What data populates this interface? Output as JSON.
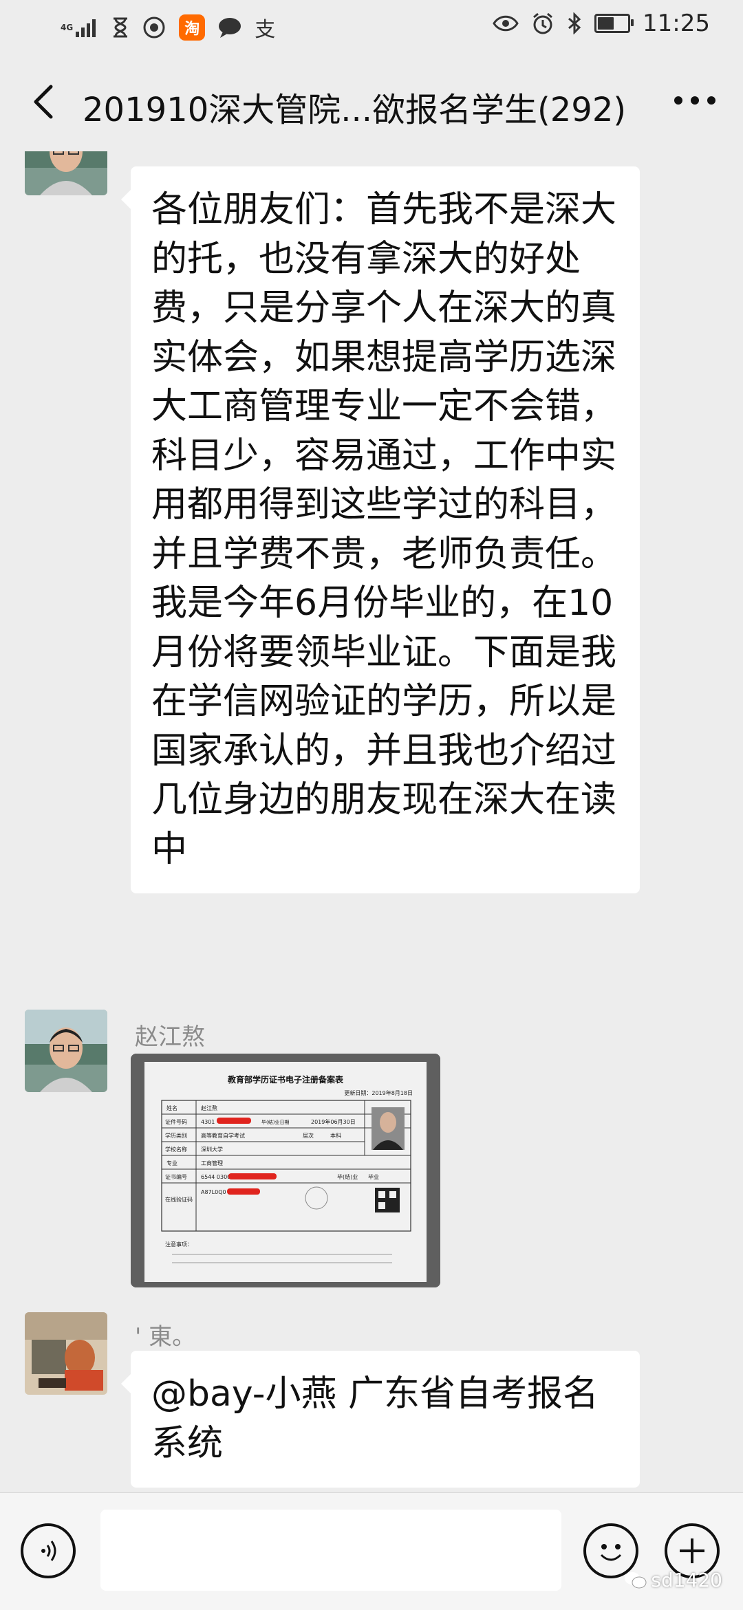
{
  "status_bar": {
    "network": "4G",
    "time": "11:25",
    "battery_level": 0.6,
    "left_icons": [
      "signal-icon",
      "hourglass-icon",
      "shield-icon",
      "taobao-icon",
      "chat-bubble-icon",
      "alipay-icon"
    ],
    "taobao_label": "淘",
    "alipay_label": "支",
    "right_icons": [
      "eye-icon",
      "alarm-icon",
      "bluetooth-icon",
      "battery-icon"
    ]
  },
  "nav": {
    "title": "201910深大管院...欲报名学生(292)",
    "back_icon": "chevron-left-icon",
    "more_icon": "more-dots-icon"
  },
  "messages": [
    {
      "sender": "赵江熬",
      "text": "各位朋友们：首先我不是深大的托，也没有拿深大的好处费，只是分享个人在深大的真实体会，如果想提高学历选深大工商管理专业一定不会错，科目少，容易通过，工作中实用都用得到这些学过的科目，并且学费不贵，老师负责任。我是今年6月份毕业的，在10月份将要领毕业证。下面是我在学信网验证的学历，所以是国家承认的，并且我也介绍过几位身边的朋友现在深大在读中"
    },
    {
      "sender": "赵江熬",
      "image": {
        "doc_title": "教育部学历证书电子注册备案表",
        "updated": "更新日期：2019年8月18日",
        "rows": [
          [
            "姓名",
            "赵江熬"
          ],
          [
            "证件号码",
            "4301"
          ],
          [
            "毕(结)业日期",
            "2019年06月30日"
          ],
          [
            "学历类别",
            "高等教育自学考试"
          ],
          [
            "层次",
            "本科"
          ],
          [
            "学校名称",
            "深圳大学"
          ],
          [
            "专业",
            "工商管理"
          ],
          [
            "证书编号",
            "6544 0300"
          ],
          [
            "毕(结)业",
            "毕业"
          ],
          [
            "在线验证码",
            "A87L0Q0"
          ]
        ],
        "footer": "注意事项："
      }
    },
    {
      "sender": "' 東。",
      "text": "@bay-小燕 广东省自考报名系统"
    }
  ],
  "input_bar": {
    "placeholder": "",
    "voice_icon": "voice-icon",
    "emoji_icon": "emoji-icon",
    "plus_icon": "plus-icon"
  },
  "watermark": "sd1420"
}
